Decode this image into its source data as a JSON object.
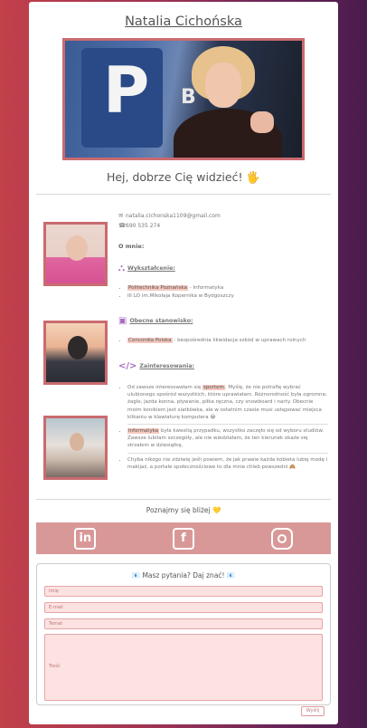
{
  "header": {
    "title": "Natalia Cichońska"
  },
  "greeting": "Hej, dobrze Cię widzieć! 🖐",
  "contact": {
    "email": "natalia.cichonska1109@gmail.com",
    "phone": "690 535 274"
  },
  "about": {
    "heading": "O mnie:",
    "education": {
      "heading": "Wykształcenie:",
      "items": [
        {
          "highlight": "Politechnika Poznańska",
          "rest": " - Informatyka"
        },
        {
          "highlight": "",
          "rest": "III LO im.Mikołaja Kopernika w Bydgoszczy"
        }
      ]
    },
    "job": {
      "heading": "Obecne stanowisko:",
      "items": [
        {
          "highlight": "Concordia Polska",
          "rest": " - bezpośrednia likwidacja szkód w uprawach rolnych"
        }
      ]
    },
    "interests": {
      "heading": "Zainteresowania:",
      "p1_before": "Od zawsze interesowałam się ",
      "p1_highlight": "sportem",
      "p1_after": ". Myślę, że nie potrafię wybrać ulubionego spośród wszystkich, które uprawiałam. Różnorodność była ogromna: żagle, jazda konna, pływanie, piłka ręczna, czy snowboard i narty. Obecnie moim konikiem jest siatkówka, ale w ostatnim czasie musi ustępować miejsca klikaniu w klawiaturę komputera 😭",
      "p2_highlight": "Informatyka",
      "p2_after": " była kwestią przypadku, wszystko zaczęło się od wyboru studiów. Zawsze lubiłam szczegóły, ale nie wiedziałam, że ten kierunek okaże się strzałem w dziesiątkę.",
      "p3": "Chyba nikogo nie zdziwię jeśli powiem, że jak prawie każda kobieta lubię modę i makijaż, a portale społecznościowe to dla mnie chleb powszedni 🙈"
    }
  },
  "social": {
    "heading": "Poznajmy się bliżej 💛",
    "icons": [
      "linkedin-icon",
      "facebook-icon",
      "instagram-icon"
    ]
  },
  "form": {
    "title": "📧 Masz pytania? Daj znać! 📧",
    "name_placeholder": "Imię",
    "email_placeholder": "E-mail",
    "subject_placeholder": "Temat",
    "message_placeholder": "Treść",
    "send_label": "Wyślij"
  }
}
